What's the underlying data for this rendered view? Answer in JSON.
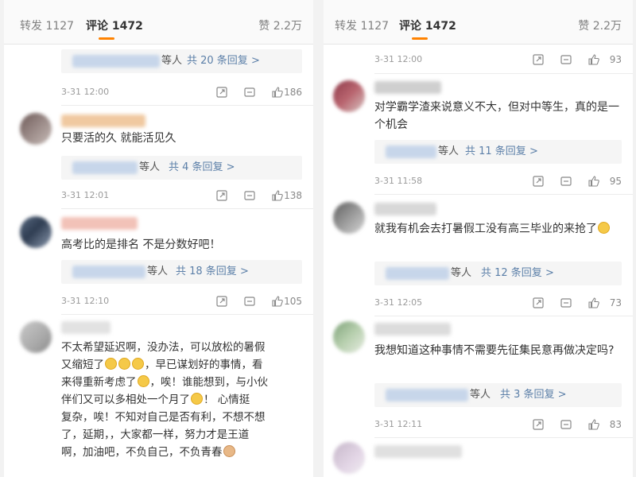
{
  "left": {
    "tabs": {
      "repost": "转发 1127",
      "comments": "评论 1472",
      "likes": "赞 2.2万"
    },
    "comments": [
      {
        "text": "",
        "reply_suffix": "等人",
        "reply_link": "共 20 条回复 >",
        "time": "3-31 12:00",
        "likes": "186"
      },
      {
        "text": "只要活的久 就能活见久",
        "reply_suffix": "等人",
        "reply_link": "共 4 条回复 >",
        "time": "3-31 12:01",
        "likes": "138"
      },
      {
        "text": "高考比的是排名 不是分数好吧！",
        "reply_suffix": "等人",
        "reply_link": "共 18 条回复 >",
        "time": "3-31 12:10",
        "likes": "105"
      },
      {
        "text_lines": [
          "不太希望延迟啊，没办法，可以放松的暑假",
          "又缩短了",
          "，早已谋划好的事情，看",
          "来得重新考虑了",
          "，唉！谁能想到，与小伙",
          "伴们又可以多相处一个月了",
          "！      心情挺",
          "复杂，唉！不知对自己是否有利，不想不想",
          "了，延期，，大家都一样，努力才是王道",
          "啊，加油吧，不负自己，不负青春"
        ]
      }
    ]
  },
  "right": {
    "tabs": {
      "repost": "转发 1127",
      "comments": "评论 1472",
      "likes": "赞 2.2万"
    },
    "comments": [
      {
        "time": "3-31 12:00",
        "likes": "93"
      },
      {
        "text": "对学霸学渣来说意义不大，但对中等生，真的是一个机会",
        "reply_suffix": "等人",
        "reply_link": "共 11 条回复 >",
        "time": "3-31 11:58",
        "likes": "95"
      },
      {
        "text": "就我有机会去打暑假工没有高三毕业的来抢了",
        "reply_suffix": "等人",
        "reply_link": "共 12 条回复 >",
        "time": "3-31 12:05",
        "likes": "73"
      },
      {
        "text": "我想知道这种事情不需要先征集民意再做决定吗?",
        "reply_suffix": "等人",
        "reply_link": "共 3 条回复 >",
        "time": "3-31 12:11",
        "likes": "83"
      }
    ]
  },
  "icons": {
    "share": "share-icon",
    "comment": "comment-icon",
    "like": "thumbs-up-icon",
    "emoji": "emoji-icon"
  },
  "colors": {
    "accent": "#ff8200",
    "link": "#5b7fa8",
    "meta": "#9a9a9a"
  }
}
